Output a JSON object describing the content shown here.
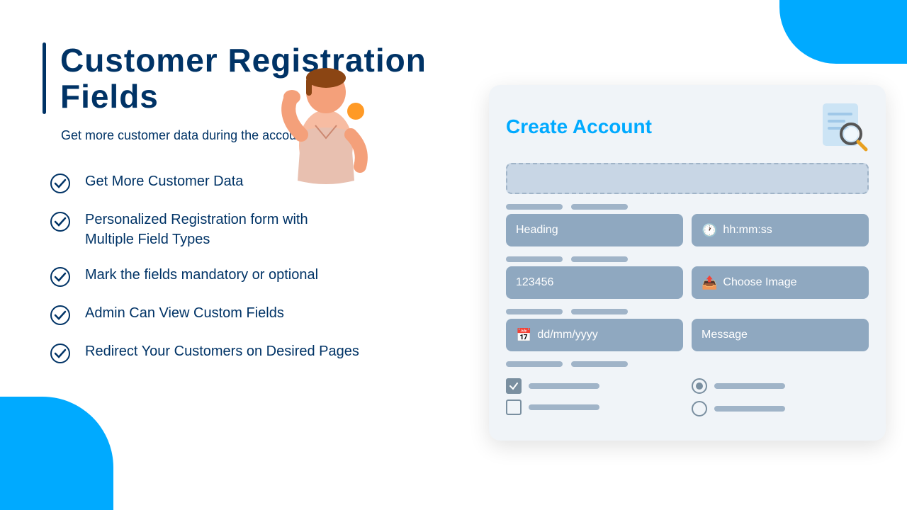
{
  "page": {
    "title": "Customer Registration Fields",
    "subtitle": "Get more customer data during the account creation",
    "features": [
      "Get More Customer Data",
      "Personalized Registration form with Multiple Field Types",
      "Mark the fields mandatory or optional",
      "Admin Can  View Custom Fields",
      "Redirect Your Customers on Desired Pages"
    ]
  },
  "form": {
    "title": "Create Account",
    "fields": {
      "heading_label": "Heading",
      "time_placeholder": "hh:mm:ss",
      "number_value": "123456",
      "image_label": "Choose Image",
      "date_placeholder": "dd/mm/yyyy",
      "message_placeholder": "Message"
    }
  },
  "colors": {
    "accent_blue": "#00aaff",
    "dark_navy": "#003366",
    "field_bg": "#8fa8c0",
    "light_field": "#c8d6e5",
    "decoration": "#a0b4c8"
  }
}
